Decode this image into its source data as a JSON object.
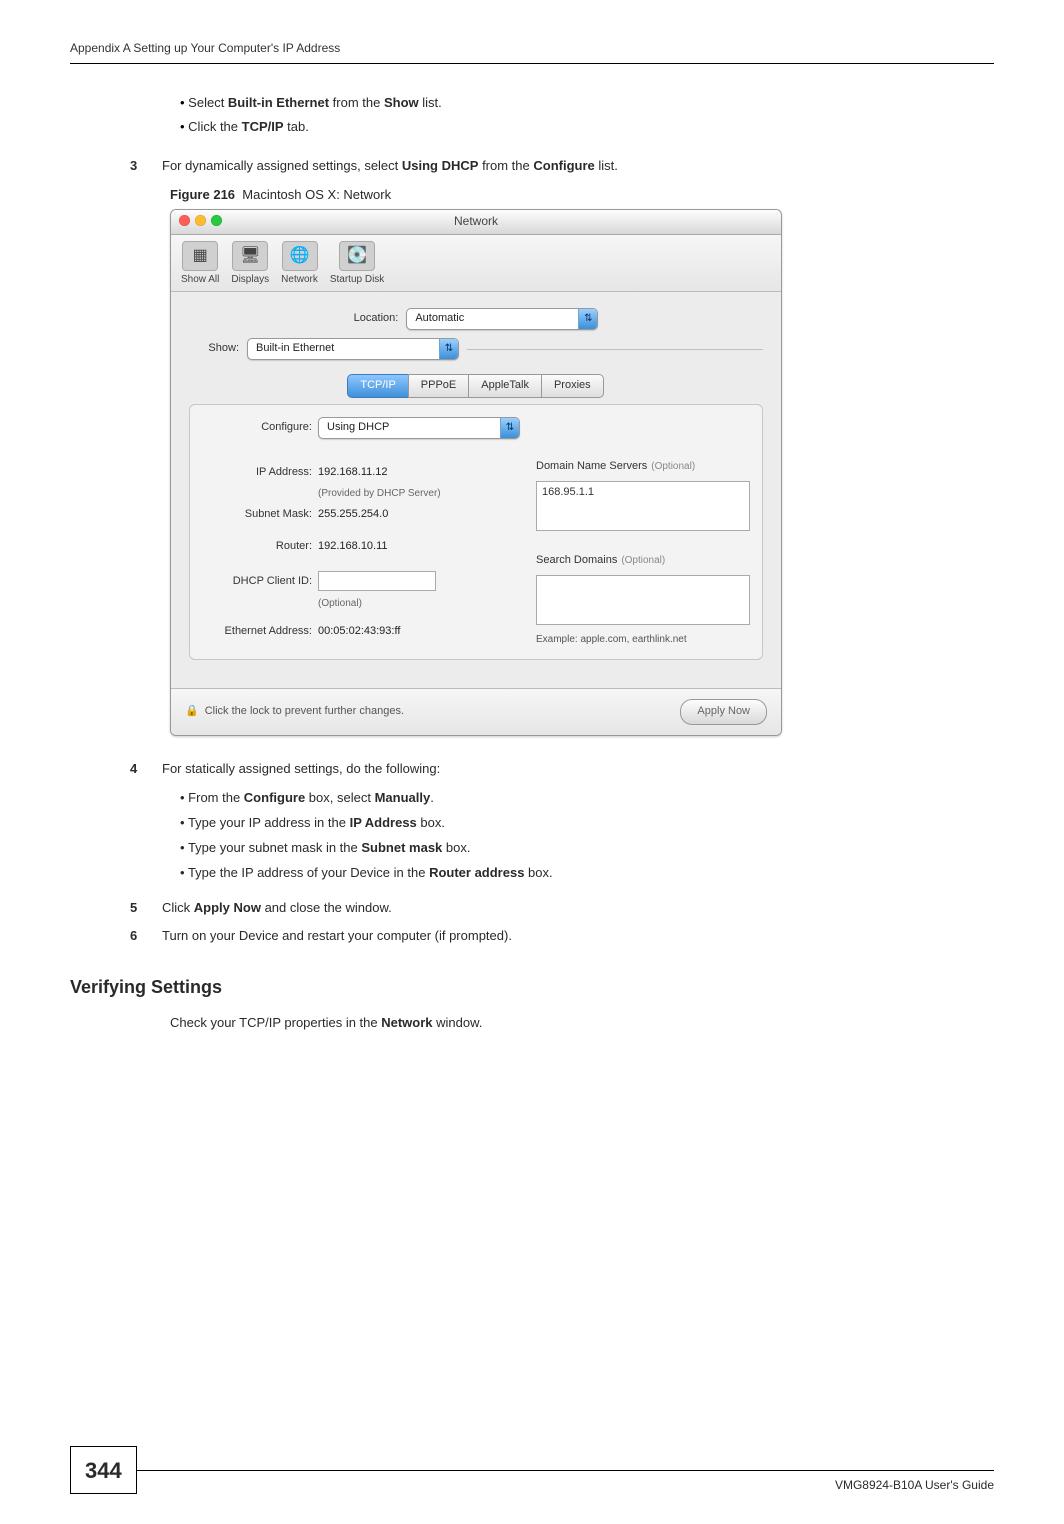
{
  "header": {
    "running_head": "Appendix A Setting up Your Computer's IP Address"
  },
  "intro_bullets": [
    {
      "pre": "Select ",
      "bold": "Built-in Ethernet",
      "mid": " from the ",
      "bold2": "Show",
      "post": " list."
    },
    {
      "pre": "Click the ",
      "bold": "TCP/IP",
      "post": " tab."
    }
  ],
  "steps": {
    "s3": {
      "num": "3",
      "pre": "For dynamically assigned settings, select ",
      "bold1": "Using DHCP",
      "mid": " from the ",
      "bold2": "Configure",
      "post": " list."
    },
    "s4": {
      "num": "4",
      "text": "For statically assigned settings, do the following:"
    },
    "s5": {
      "num": "5",
      "pre": "Click ",
      "bold": "Apply Now",
      "post": " and close the window."
    },
    "s6": {
      "num": "6",
      "text": "Turn on your Device and restart your computer (if prompted)."
    }
  },
  "figure": {
    "label": "Figure 216",
    "caption": "Macintosh OS X: Network"
  },
  "screenshot": {
    "window_title": "Network",
    "toolbar": {
      "show_all": "Show All",
      "displays": "Displays",
      "network": "Network",
      "startup_disk": "Startup Disk"
    },
    "location_label": "Location:",
    "location_value": "Automatic",
    "show_label": "Show:",
    "show_value": "Built-in Ethernet",
    "tabs": {
      "tcpip": "TCP/IP",
      "pppoe": "PPPoE",
      "appletalk": "AppleTalk",
      "proxies": "Proxies"
    },
    "configure_label": "Configure:",
    "configure_value": "Using DHCP",
    "dns_heading": "Domain Name Servers",
    "dns_optional": "(Optional)",
    "dns_value": "168.95.1.1",
    "ip_label": "IP Address:",
    "ip_value": "192.168.11.12",
    "ip_note": "(Provided by DHCP Server)",
    "subnet_label": "Subnet Mask:",
    "subnet_value": "255.255.254.0",
    "router_label": "Router:",
    "router_value": "192.168.10.11",
    "search_heading": "Search Domains",
    "search_optional": "(Optional)",
    "dhcp_client_label": "DHCP Client ID:",
    "dhcp_note": "(Optional)",
    "example_line": "Example: apple.com, earthlink.net",
    "eth_label": "Ethernet Address:",
    "eth_value": "00:05:02:43:93:ff",
    "lock_text": "Click the lock to prevent further changes.",
    "apply_btn": "Apply Now"
  },
  "step4_bullets": {
    "b1": {
      "pre": "From the ",
      "bold": "Configure",
      "mid": " box, select ",
      "bold2": "Manually",
      "post": "."
    },
    "b2": {
      "pre": "Type your IP address in the ",
      "bold": "IP Address",
      "post": " box."
    },
    "b3": {
      "pre": "Type your subnet mask in the ",
      "bold": "Subnet mask",
      "post": " box."
    },
    "b4": {
      "pre": "Type the IP address of your Device in the ",
      "bold": "Router address",
      "post": " box."
    }
  },
  "verify": {
    "heading": "Verifying Settings",
    "pre": "Check your TCP/IP properties in the ",
    "bold": "Network",
    "post": " window."
  },
  "footer": {
    "page": "344",
    "guide": "VMG8924-B10A User's Guide"
  }
}
